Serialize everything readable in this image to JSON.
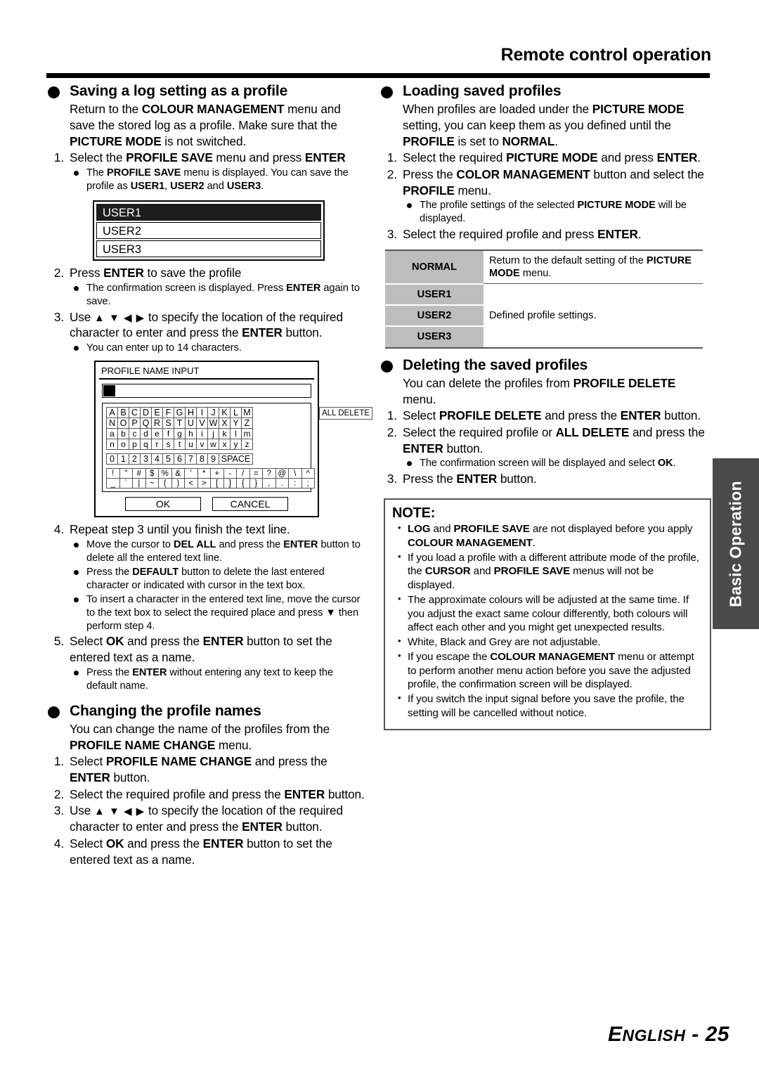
{
  "header": {
    "title": "Remote control operation"
  },
  "footer": {
    "language": "ENGLISH",
    "separator": "-",
    "page": "25"
  },
  "side_tab": {
    "label": "Basic Operation"
  },
  "left_column": {
    "section_saving": {
      "heading": "Saving a log setting as a profile",
      "intro": "Return to the COLOUR MANAGEMENT menu and save the stored log as a profile. Make sure that the PICTURE MODE is not switched.",
      "steps": [
        {
          "num": "1.",
          "text": "Select the PROFILE SAVE menu and press ENTER",
          "subs": [
            "The PROFILE SAVE menu is displayed. You can save the profile as USER1, USER2 and USER3."
          ]
        },
        {
          "num": "2.",
          "text": "Press ENTER to save the profile",
          "subs": [
            "The confirmation screen is displayed. Press ENTER again to save."
          ]
        },
        {
          "num": "3.",
          "text": "Use ▲ ▼ ◀ ▶ to specify the location of the required character to enter and press the ENTER button.",
          "subs": [
            "You can enter up to 14 characters."
          ]
        },
        {
          "num": "4.",
          "text": "Repeat step 3 until you finish the text line.",
          "subs": [
            "Move the cursor to DEL ALL and press the ENTER button to delete all the entered text line.",
            "Press the DEFAULT button to delete the last entered character or indicated with cursor in the text box.",
            "To insert a character in the entered text line, move the cursor to the text box to select the required place and press ▼ then perform step 4."
          ]
        },
        {
          "num": "5.",
          "text": "Select OK and press the ENTER button to set the entered text as a name.",
          "subs": [
            "Press the ENTER without entering any text to keep the default name."
          ]
        }
      ]
    },
    "profile_save_menu": {
      "items": [
        {
          "label": "USER1",
          "selected": true
        },
        {
          "label": "USER2",
          "selected": false
        },
        {
          "label": "USER3",
          "selected": false
        }
      ]
    },
    "profile_name_input": {
      "title": "PROFILE NAME INPUT",
      "text_value": "",
      "all_delete_label": "ALL DELETE",
      "rows_upper_1": [
        "A",
        "B",
        "C",
        "D",
        "E",
        "F",
        "G",
        "H",
        "I",
        "J",
        "K",
        "L",
        "M"
      ],
      "rows_upper_2": [
        "N",
        "O",
        "P",
        "Q",
        "R",
        "S",
        "T",
        "U",
        "V",
        "W",
        "X",
        "Y",
        "Z"
      ],
      "rows_lower_1": [
        "a",
        "b",
        "c",
        "d",
        "e",
        "f",
        "g",
        "h",
        "i",
        "j",
        "k",
        "l",
        "m"
      ],
      "rows_lower_2": [
        "n",
        "o",
        "p",
        "q",
        "r",
        "s",
        "t",
        "u",
        "v",
        "w",
        "x",
        "y",
        "z"
      ],
      "rows_digits": [
        "0",
        "1",
        "2",
        "3",
        "4",
        "5",
        "6",
        "7",
        "8",
        "9"
      ],
      "space_label": "SPACE",
      "rows_symbol_1": [
        "!",
        "\"",
        "#",
        "$",
        "%",
        "&",
        "'",
        "*",
        "+",
        "-",
        "/",
        "=",
        "?",
        "@",
        "\\",
        "^"
      ],
      "rows_symbol_2": [
        "_",
        "`",
        "|",
        "~",
        "(",
        ")",
        "<",
        ">",
        "[",
        "]",
        "{",
        "}",
        ",",
        ".",
        ":",
        ";"
      ],
      "ok_label": "OK",
      "cancel_label": "CANCEL"
    },
    "section_changing": {
      "heading": "Changing the profile names",
      "intro": "You can change the name of the profiles from the PROFILE NAME CHANGE menu.",
      "steps": [
        {
          "num": "1.",
          "text": "Select PROFILE NAME CHANGE and press the ENTER button."
        },
        {
          "num": "2.",
          "text": "Select the required profile and press the ENTER button."
        },
        {
          "num": "3.",
          "text": "Use ▲ ▼ ◀ ▶ to specify the location of the required character to enter and press the ENTER button."
        },
        {
          "num": "4.",
          "text": "Select OK and press the ENTER button to set the entered text as a name."
        }
      ]
    }
  },
  "right_column": {
    "section_loading": {
      "heading": "Loading saved profiles",
      "intro": "When profiles are loaded under the PICTURE MODE setting, you can keep them as you defined until the PROFILE is set to NORMAL.",
      "steps": [
        {
          "num": "1.",
          "text": "Select the required PICTURE MODE and press ENTER."
        },
        {
          "num": "2.",
          "text": "Press the COLOR MANAGEMENT button and select the PROFILE menu.",
          "subs": [
            "The profile settings of the selected PICTURE MODE will be displayed."
          ]
        },
        {
          "num": "3.",
          "text": "Select the required profile and press ENTER."
        }
      ]
    },
    "profile_table": {
      "rows": [
        {
          "key": "NORMAL",
          "value": "Return to the default setting of the PICTURE MODE menu."
        },
        {
          "key": "USER1",
          "value": ""
        },
        {
          "key": "USER2",
          "value": "Defined profile settings."
        },
        {
          "key": "USER3",
          "value": ""
        }
      ]
    },
    "section_deleting": {
      "heading": "Deleting the saved profiles",
      "intro": "You can delete the profiles from PROFILE DELETE menu.",
      "steps": [
        {
          "num": "1.",
          "text": "Select PROFILE DELETE and press the ENTER button."
        },
        {
          "num": "2.",
          "text": "Select the required profile or ALL DELETE and press the ENTER button.",
          "subs": [
            "The confirmation screen will be displayed and select OK."
          ]
        },
        {
          "num": "3.",
          "text": "Press the ENTER button."
        }
      ]
    },
    "note": {
      "title": "NOTE:",
      "items": [
        "LOG and PROFILE SAVE are not displayed before you apply COLOUR MANAGEMENT.",
        "If you load a profile with a different attribute mode of the profile, the CURSOR and PROFILE SAVE menus will not be displayed.",
        "The approximate colours will be adjusted at the same time. If you adjust the exact same colour differently, both colours will affect each other and you might get unexpected results.",
        "White, Black and Grey are not adjustable.",
        "If you escape the COLOUR MANAGEMENT menu or attempt to perform another menu action before you save the adjusted profile, the confirmation screen will be displayed.",
        "If you switch the input signal before you save the profile, the setting will be cancelled without notice."
      ]
    }
  },
  "bold_terms": [
    "COLOUR MANAGEMENT",
    "PICTURE MODE",
    "PROFILE SAVE",
    "ENTER",
    "USER1",
    "USER2",
    "USER3",
    "DEL ALL",
    "DEFAULT",
    "OK",
    "PROFILE NAME CHANGE",
    "COLOR MANAGEMENT",
    "PROFILE",
    "NORMAL",
    "PROFILE DELETE",
    "ALL DELETE",
    "LOG",
    "CURSOR"
  ],
  "colors": {
    "ink": "#000000",
    "tab_bg": "#4a4a4a",
    "table_key_bg": "#bdbdbd",
    "rule": "#555555"
  }
}
